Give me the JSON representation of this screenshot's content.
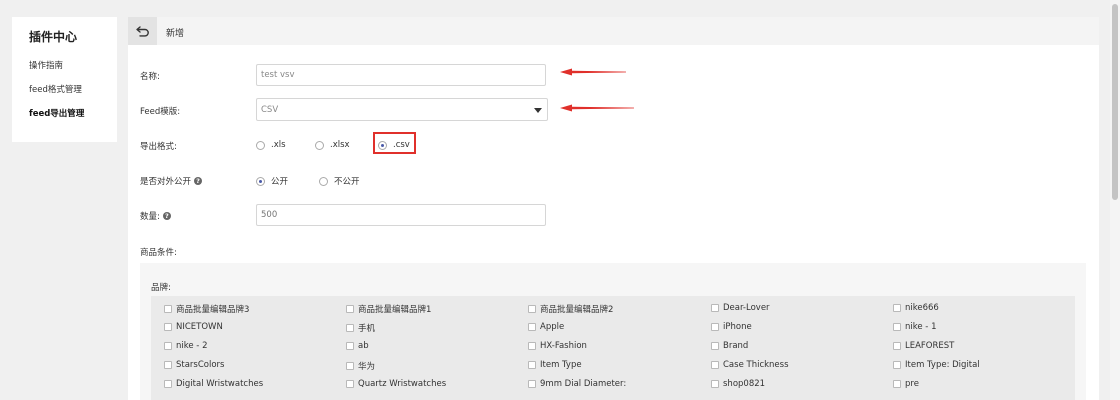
{
  "sidebar": {
    "title": "插件中心",
    "items": [
      {
        "label": "操作指南"
      },
      {
        "label": "feed格式管理"
      },
      {
        "label": "feed导出管理"
      }
    ]
  },
  "header": {
    "title": "新增"
  },
  "form": {
    "name": {
      "label": "名称:",
      "value": "test vsv"
    },
    "template": {
      "label": "Feed模版:",
      "value": "CSV"
    },
    "format": {
      "label": "导出格式:",
      "options": [
        {
          "label": ".xls",
          "checked": false
        },
        {
          "label": ".xlsx",
          "checked": false
        },
        {
          "label": ".csv",
          "checked": true
        }
      ]
    },
    "public": {
      "label": "是否对外公开",
      "options": [
        {
          "label": "公开",
          "checked": true
        },
        {
          "label": "不公开",
          "checked": false
        }
      ]
    },
    "quantity": {
      "label": "数量:",
      "placeholder": "500"
    },
    "conditions_label": "商品条件:",
    "brand_label": "品牌:",
    "brands": [
      [
        "商品批量编辑品牌3",
        "商品批量编辑品牌1",
        "商品批量编辑品牌2",
        "Dear-Lover",
        "nike666"
      ],
      [
        "NICETOWN",
        "手机",
        "Apple",
        "iPhone",
        "nike - 1"
      ],
      [
        "nike - 2",
        "ab",
        "HX-Fashion",
        "Brand",
        "LEAFOREST"
      ],
      [
        "StarsColors",
        "华为",
        "Item Type",
        "Case Thickness",
        "Item Type: Digital"
      ],
      [
        "Digital Wristwatches",
        "Quartz Wristwatches",
        "9mm Dial Diameter:",
        "shop0821",
        "pre"
      ]
    ]
  },
  "colors": {
    "accent": "#4a5aa8",
    "annotation_red": "#e0302b"
  }
}
